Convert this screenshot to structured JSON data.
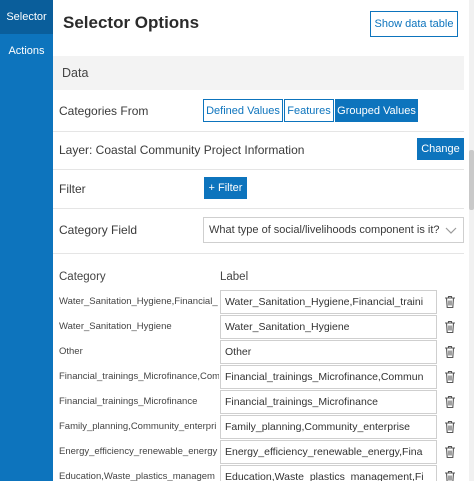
{
  "sidebar": {
    "tabs": [
      {
        "label": "Selector",
        "active": true
      },
      {
        "label": "Actions",
        "active": false
      }
    ]
  },
  "header": {
    "title": "Selector Options",
    "show_data_table": "Show data table"
  },
  "data_section": {
    "title": "Data"
  },
  "categories_from": {
    "label": "Categories From",
    "options": [
      "Defined Values",
      "Features",
      "Grouped Values"
    ],
    "selected": "Grouped Values"
  },
  "layer": {
    "text": "Layer: Coastal Community Project Information",
    "change_button": "Change"
  },
  "filter": {
    "label": "Filter",
    "button": "+ Filter"
  },
  "category_field": {
    "label": "Category Field",
    "value": "What type of social/livelihoods component is it?"
  },
  "table": {
    "col_category": "Category",
    "col_label": "Label",
    "rows": [
      {
        "category": "Water_Sanitation_Hygiene,Financial_",
        "label": "Water_Sanitation_Hygiene,Financial_traini"
      },
      {
        "category": "Water_Sanitation_Hygiene",
        "label": "Water_Sanitation_Hygiene"
      },
      {
        "category": "Other",
        "label": "Other"
      },
      {
        "category": "Financial_trainings_Microfinance,Com",
        "label": "Financial_trainings_Microfinance,Commun"
      },
      {
        "category": "Financial_trainings_Microfinance",
        "label": "Financial_trainings_Microfinance"
      },
      {
        "category": "Family_planning,Community_enterpri",
        "label": "Family_planning,Community_enterprise"
      },
      {
        "category": "Energy_efficiency_renewable_energy",
        "label": "Energy_efficiency_renewable_energy,Fina"
      },
      {
        "category": "Education,Waste_plastics_managem",
        "label": "Education,Waste_plastics_management,Fi"
      }
    ]
  },
  "colors": {
    "accent": "#0d74bd",
    "rail": "#0d74bd",
    "rail_active": "#0a5e9b",
    "section_bg": "#f3f3f3"
  },
  "icons": {
    "delete": "trash-icon",
    "dropdown": "chevron-down-icon"
  }
}
